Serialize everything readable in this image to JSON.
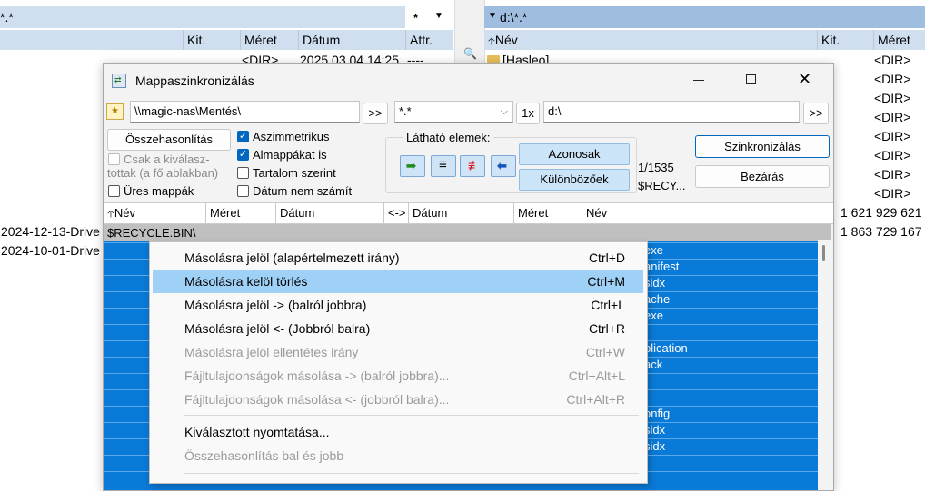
{
  "left_panel": {
    "filter": "*.*",
    "filter_btn": "*",
    "columns": [
      "Kit.",
      "Méret",
      "Dátum",
      "Attr."
    ],
    "first_row": {
      "size": "<DIR>",
      "date": "2025.03.04 14:25",
      "attr": "----"
    },
    "rows": [
      "2024-12-13-Drive",
      "2024-10-01-Drive"
    ]
  },
  "right_panel": {
    "path": "d:\\*.*",
    "columns": [
      "Név",
      "Kit.",
      "Méret"
    ],
    "first_item": "[Hasleo]",
    "dir_values": [
      "<DIR>",
      "<DIR>",
      "<DIR>",
      "<DIR>",
      "<DIR>",
      "<DIR>",
      "<DIR>",
      "<DIR>"
    ],
    "sizes": [
      "1 621 929 621",
      "1 863 729 167"
    ]
  },
  "dialog": {
    "title": "Mappaszinkronizálás",
    "left_path": "\\\\magic-nas\\Mentés\\",
    "browse_left": ">>",
    "filter": "*.*",
    "once": "1x",
    "right_path": "d:\\",
    "browse_right": ">>",
    "compare_button": "Összehasonlítás",
    "selected_only": "Csak a kiválasz-\ntottak (a fő ablakban)",
    "empty_dirs": "Üres mappák",
    "asymmetric": "Aszimmetrikus",
    "subdirs": "Almappákat is",
    "by_content": "Tartalom szerint",
    "ignore_date": "Dátum nem számít",
    "visible_items": "Látható elemek:",
    "identical_button": "Azonosak",
    "different_button": "Különbözőek",
    "count": "1/1535",
    "recycle_short": "$RECY...",
    "sync_button": "Szinkronizálás",
    "close_button": "Bezárás",
    "list_headers": [
      "Név",
      "Méret",
      "Dátum",
      "<->",
      "Dátum",
      "Méret",
      "Név"
    ],
    "first_row": "$RECYCLE.BIN\\",
    "right_names": [
      "exe",
      "anifest",
      "sidx",
      "ache",
      "exe",
      "",
      "plication",
      "ack",
      "",
      "",
      "onfig",
      "sidx",
      "sidx"
    ]
  },
  "context_menu": {
    "items": [
      {
        "label": "Másolásra jelöl (alapértelmezett irány)",
        "shortcut": "Ctrl+D",
        "disabled": false,
        "highlighted": false
      },
      {
        "label": "Másolásra kelöl törlés",
        "shortcut": "Ctrl+M",
        "disabled": false,
        "highlighted": true
      },
      {
        "label": "Másolásra jelöl -> (balról jobbra)",
        "shortcut": "Ctrl+L",
        "disabled": false,
        "highlighted": false
      },
      {
        "label": "Másolásra jelöl <- (Jobbról balra)",
        "shortcut": "Ctrl+R",
        "disabled": false,
        "highlighted": false
      },
      {
        "label": "Másolásra jelöl ellentétes irány",
        "shortcut": "Ctrl+W",
        "disabled": true,
        "highlighted": false
      },
      {
        "label": "Fájltulajdonságok másolása -> (balról jobbra)...",
        "shortcut": "Ctrl+Alt+L",
        "disabled": true,
        "highlighted": false
      },
      {
        "label": "Fájltulajdonságok másolása <- (jobbról balra)...",
        "shortcut": "Ctrl+Alt+R",
        "disabled": true,
        "highlighted": false
      },
      {
        "label": "Kiválasztott nyomtatása...",
        "shortcut": "",
        "disabled": false,
        "highlighted": false
      },
      {
        "label": "Összehasonlítás bal és jobb",
        "shortcut": "",
        "disabled": true,
        "highlighted": false
      }
    ]
  },
  "colors": {
    "selection_blue": "#0a7ad8",
    "accent": "#0067c0",
    "highlight": "#9fd0f5"
  }
}
